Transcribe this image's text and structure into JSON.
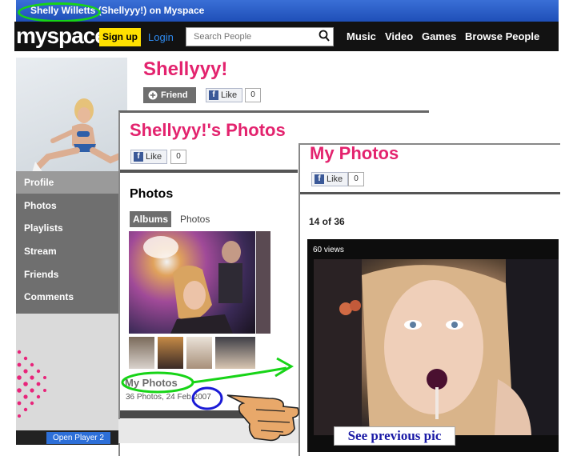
{
  "window": {
    "title_highlight": "Shelly Willetts",
    "title_rest": "(Shellyyy!) on Myspace"
  },
  "nav": {
    "logo": "myspace",
    "signup": "Sign up",
    "login": "Login",
    "search_placeholder": "Search People",
    "links": [
      "Music",
      "Video",
      "Games",
      "Browse People"
    ]
  },
  "profile": {
    "name": "Shellyyy!",
    "friend_label": "Friend",
    "like_label": "Like",
    "like_count": "0",
    "menu": [
      "Profile",
      "Photos",
      "Playlists",
      "Stream",
      "Friends",
      "Comments"
    ],
    "player_label": "Open Player 2"
  },
  "photos_window": {
    "title": "Shellyyy!'s Photos",
    "like_label": "Like",
    "like_count": "0",
    "section_title": "Photos",
    "tabs": [
      "Albums",
      "Photos"
    ],
    "album_name": "My Photos",
    "album_meta": "36 Photos, 24 Feb ",
    "album_year": "2007"
  },
  "myphotos_window": {
    "title": "My Photos",
    "like_label": "Like",
    "like_count": "0",
    "counter": "14 of 36",
    "views": "60 views",
    "caption": "See previous pic"
  },
  "colors": {
    "accent_pink": "#e3236e",
    "annotation_green": "#17d417",
    "annotation_blue": "#1a1ad6",
    "signup_yellow": "#ffe100"
  }
}
